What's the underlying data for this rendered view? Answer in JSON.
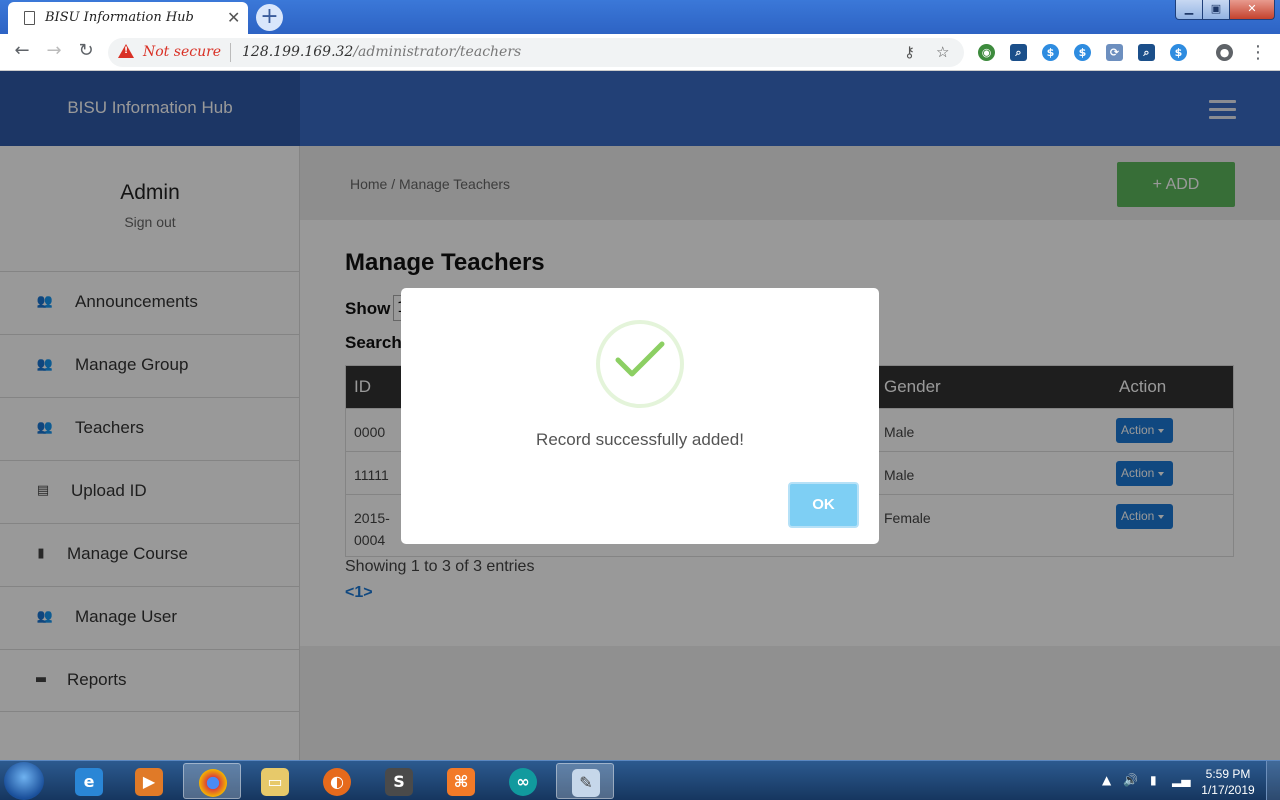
{
  "browser": {
    "tab_title": "BISU Information Hub",
    "new_tab": "+",
    "security_label": "Not secure",
    "url_host": "128.199.169.32",
    "url_path": "/administrator/teachers"
  },
  "header": {
    "brand": "BISU Information Hub"
  },
  "sidebar": {
    "user_name": "Admin",
    "sign_out": "Sign out",
    "items": [
      {
        "label": "Announcements",
        "icon": "users-icon"
      },
      {
        "label": "Manage Group",
        "icon": "users-icon"
      },
      {
        "label": "Teachers",
        "icon": "users-icon"
      },
      {
        "label": "Upload ID",
        "icon": "id-card-icon"
      },
      {
        "label": "Manage Course",
        "icon": "bookmark-icon"
      },
      {
        "label": "Manage User",
        "icon": "users-icon"
      },
      {
        "label": "Reports",
        "icon": "file-icon"
      }
    ]
  },
  "main": {
    "breadcrumb": "Home  /  Manage Teachers",
    "add_button": "+ ADD",
    "title": "Manage Teachers",
    "show_label": "Show",
    "show_value": "1",
    "search_label": "Search",
    "table": {
      "headers": [
        "ID",
        "Gender",
        "Action"
      ],
      "rows": [
        {
          "id": "0000",
          "gender": "Male",
          "action": "Action"
        },
        {
          "id": "11111",
          "gender": "Male",
          "action": "Action"
        },
        {
          "id_line1": "2015-",
          "id_line2": "0004",
          "gender": "Female",
          "action": "Action"
        }
      ]
    },
    "showing": "Showing 1 to 3 of 3 entries",
    "pager": "<1>"
  },
  "modal": {
    "message": "Record successfully added!",
    "ok": "OK"
  },
  "taskbar": {
    "time": "5:59 PM",
    "date": "1/17/2019"
  }
}
